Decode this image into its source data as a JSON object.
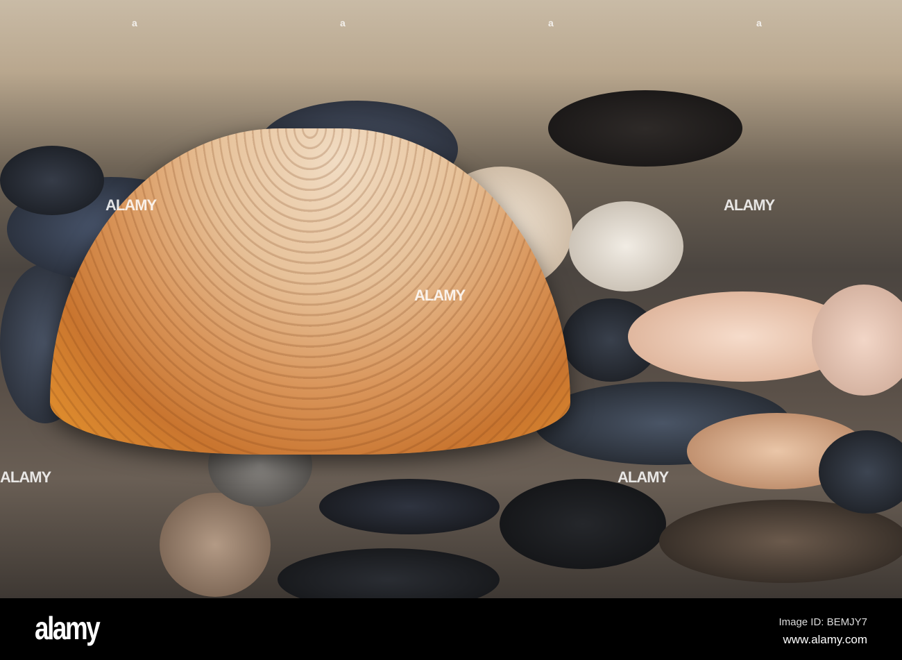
{
  "watermark": {
    "text": "ALAMY",
    "marker": "a"
  },
  "footer": {
    "logo": "alamy",
    "image_id": "Image ID: BEMJY7",
    "url": "www.alamy.com"
  }
}
